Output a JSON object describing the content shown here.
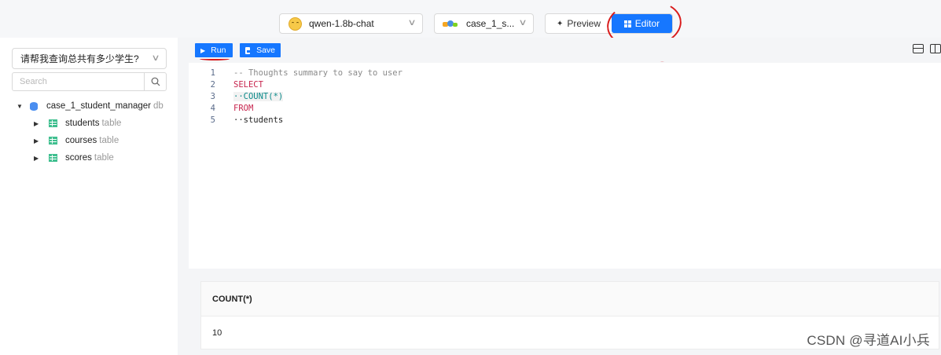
{
  "header": {
    "model_select": {
      "value": "qwen-1.8b-chat",
      "icon": "hugging-face-icon"
    },
    "db_select": {
      "value": "case_1_s..."
    },
    "mode": {
      "preview_label": "Preview",
      "editor_label": "Editor",
      "active": "Editor",
      "active_color": "#1677ff"
    }
  },
  "sidebar": {
    "question": "请帮我查询总共有多少学生?",
    "search_placeholder": "Search",
    "tree": {
      "root": {
        "name": "case_1_student_manager",
        "suffix": "db"
      },
      "children": [
        {
          "name": "students",
          "suffix": "table"
        },
        {
          "name": "courses",
          "suffix": "table"
        },
        {
          "name": "scores",
          "suffix": "table"
        }
      ]
    }
  },
  "toolbar": {
    "run_label": "Run",
    "save_label": "Save"
  },
  "editor": {
    "lines": [
      {
        "num": "1",
        "text": "-- Thoughts summary to say to user"
      },
      {
        "num": "2",
        "text": "SELECT"
      },
      {
        "num": "3",
        "text": "··COUNT(*)"
      },
      {
        "num": "4",
        "text": "FROM"
      },
      {
        "num": "5",
        "text": "··students"
      }
    ]
  },
  "results": {
    "columns": [
      "COUNT(*)"
    ],
    "rows": [
      [
        "10"
      ]
    ]
  },
  "watermark": "CSDN @寻道AI小兵",
  "colors": {
    "accent": "#1677ff",
    "annotation": "#d91c1c"
  }
}
